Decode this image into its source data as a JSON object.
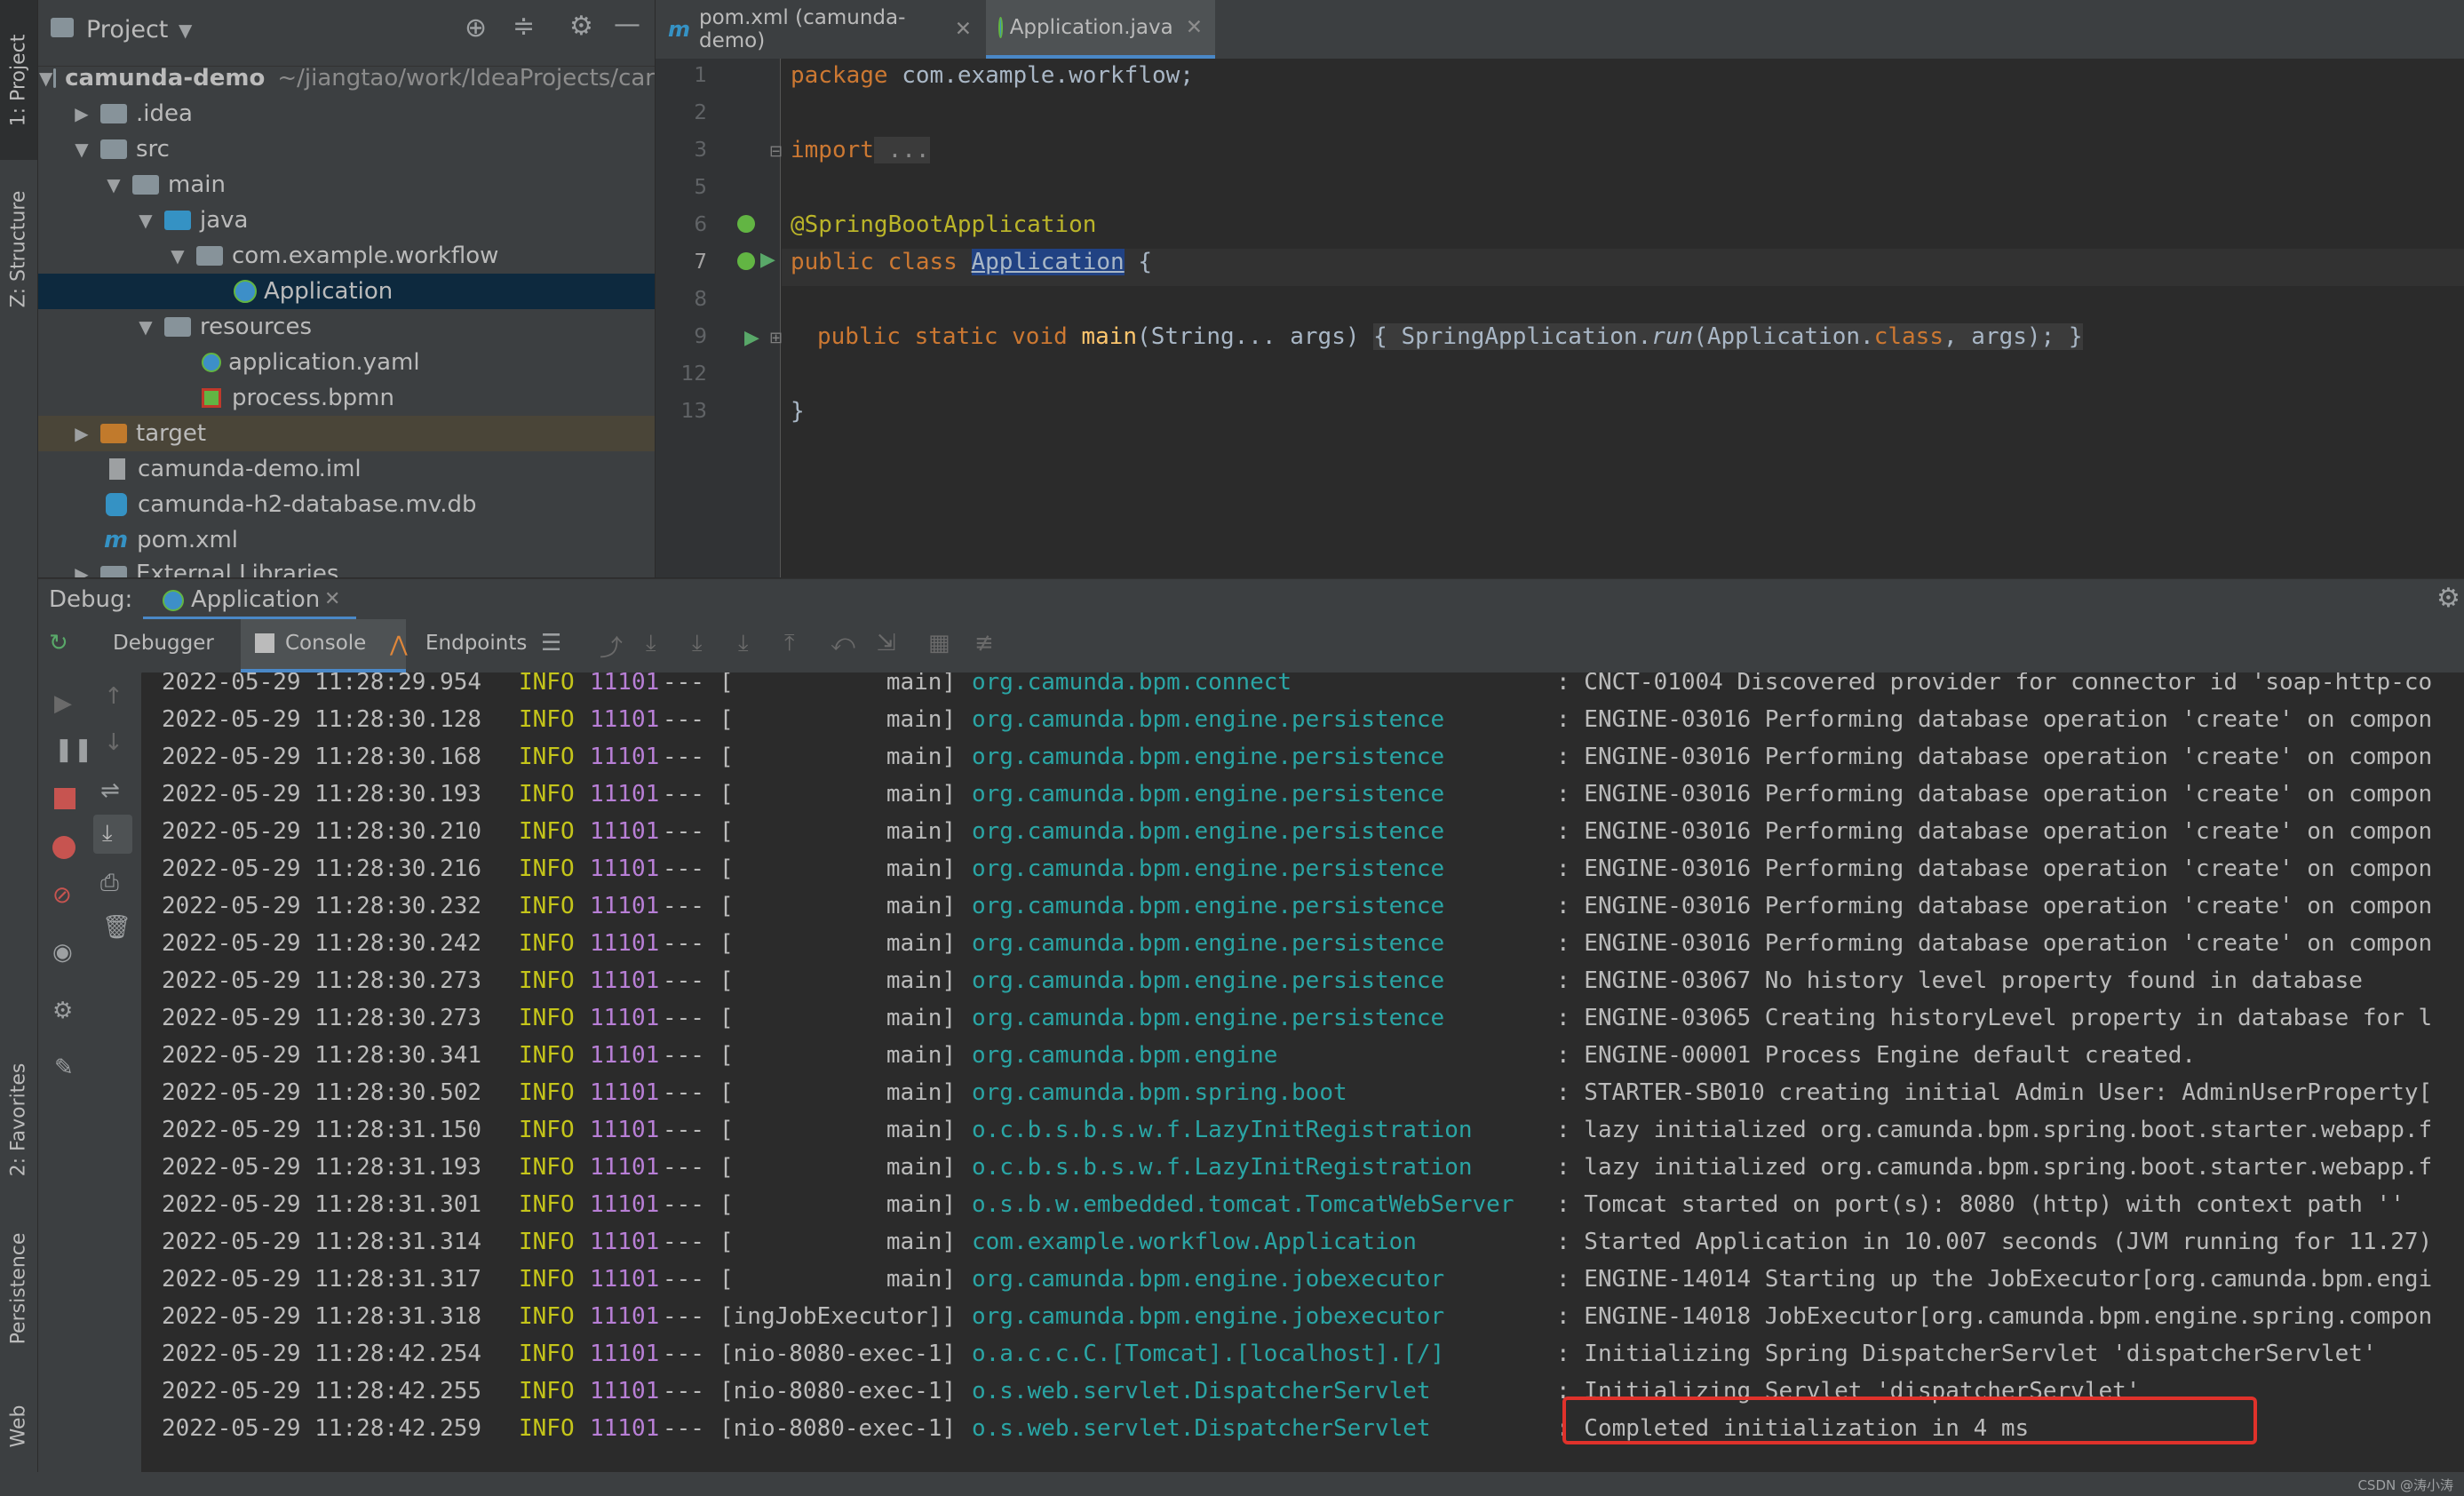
{
  "left_strip": {
    "project_tab": "1: Project",
    "structure_tab": "Z: Structure",
    "favorites_tab": "2: Favorites",
    "persistence_tab": "Persistence",
    "web_tab": "Web"
  },
  "project": {
    "title": "Project",
    "tree": [
      {
        "label": "camunda-demo",
        "path": "~/jiangtao/work/IdeaProjects/car"
      },
      {
        "label": ".idea"
      },
      {
        "label": "src"
      },
      {
        "label": "main"
      },
      {
        "label": "java"
      },
      {
        "label": "com.example.workflow"
      },
      {
        "label": "Application"
      },
      {
        "label": "resources"
      },
      {
        "label": "application.yaml"
      },
      {
        "label": "process.bpmn"
      },
      {
        "label": "target"
      },
      {
        "label": "camunda-demo.iml"
      },
      {
        "label": "camunda-h2-database.mv.db"
      },
      {
        "label": "pom.xml"
      },
      {
        "label": "External Libraries"
      }
    ]
  },
  "editor": {
    "tabs": [
      {
        "label": "pom.xml (camunda-demo)"
      },
      {
        "label": "Application.java"
      }
    ],
    "line_numbers": [
      "1",
      "2",
      "3",
      "5",
      "6",
      "7",
      "8",
      "9",
      "12",
      "13"
    ],
    "code": {
      "l1_kw": "package",
      "l1_rest": " com.example.workflow;",
      "l3_kw": "import",
      "l3_fold": " ...",
      "l6_ann": "@SpringBootApplication",
      "l7_kw": "public class ",
      "l7_cls": "Application",
      "l7_rest": " {",
      "l9_kw": "public static void ",
      "l9_fn": "main",
      "l9_args": "(String... args) ",
      "l9_body": "{ SpringApplication.",
      "l9_run": "run",
      "l9_app": "(Application.",
      "l9_class": "class",
      "l9_end": ", args); }",
      "l13": "}"
    }
  },
  "debug": {
    "label": "Debug:",
    "session": "Application",
    "tabs": {
      "debugger": "Debugger",
      "console": "Console",
      "endpoints": "Endpoints"
    }
  },
  "console": {
    "rows": [
      {
        "ts": "2022-05-29 11:28:29.954",
        "level": "INFO",
        "pid": "11101",
        "sep": "---",
        "thread": "[           main]",
        "logger": "org.camunda.bpm.connect",
        "msg": ": CNCT-01004 Discovered provider for connector id 'soap-http-co"
      },
      {
        "ts": "2022-05-29 11:28:30.128",
        "level": "INFO",
        "pid": "11101",
        "sep": "---",
        "thread": "[           main]",
        "logger": "org.camunda.bpm.engine.persistence",
        "msg": ": ENGINE-03016 Performing database operation 'create' on compon"
      },
      {
        "ts": "2022-05-29 11:28:30.168",
        "level": "INFO",
        "pid": "11101",
        "sep": "---",
        "thread": "[           main]",
        "logger": "org.camunda.bpm.engine.persistence",
        "msg": ": ENGINE-03016 Performing database operation 'create' on compon"
      },
      {
        "ts": "2022-05-29 11:28:30.193",
        "level": "INFO",
        "pid": "11101",
        "sep": "---",
        "thread": "[           main]",
        "logger": "org.camunda.bpm.engine.persistence",
        "msg": ": ENGINE-03016 Performing database operation 'create' on compon"
      },
      {
        "ts": "2022-05-29 11:28:30.210",
        "level": "INFO",
        "pid": "11101",
        "sep": "---",
        "thread": "[           main]",
        "logger": "org.camunda.bpm.engine.persistence",
        "msg": ": ENGINE-03016 Performing database operation 'create' on compon"
      },
      {
        "ts": "2022-05-29 11:28:30.216",
        "level": "INFO",
        "pid": "11101",
        "sep": "---",
        "thread": "[           main]",
        "logger": "org.camunda.bpm.engine.persistence",
        "msg": ": ENGINE-03016 Performing database operation 'create' on compon"
      },
      {
        "ts": "2022-05-29 11:28:30.232",
        "level": "INFO",
        "pid": "11101",
        "sep": "---",
        "thread": "[           main]",
        "logger": "org.camunda.bpm.engine.persistence",
        "msg": ": ENGINE-03016 Performing database operation 'create' on compon"
      },
      {
        "ts": "2022-05-29 11:28:30.242",
        "level": "INFO",
        "pid": "11101",
        "sep": "---",
        "thread": "[           main]",
        "logger": "org.camunda.bpm.engine.persistence",
        "msg": ": ENGINE-03016 Performing database operation 'create' on compon"
      },
      {
        "ts": "2022-05-29 11:28:30.273",
        "level": "INFO",
        "pid": "11101",
        "sep": "---",
        "thread": "[           main]",
        "logger": "org.camunda.bpm.engine.persistence",
        "msg": ": ENGINE-03067 No history level property found in database"
      },
      {
        "ts": "2022-05-29 11:28:30.273",
        "level": "INFO",
        "pid": "11101",
        "sep": "---",
        "thread": "[           main]",
        "logger": "org.camunda.bpm.engine.persistence",
        "msg": ": ENGINE-03065 Creating historyLevel property in database for l"
      },
      {
        "ts": "2022-05-29 11:28:30.341",
        "level": "INFO",
        "pid": "11101",
        "sep": "---",
        "thread": "[           main]",
        "logger": "org.camunda.bpm.engine",
        "msg": ": ENGINE-00001 Process Engine default created."
      },
      {
        "ts": "2022-05-29 11:28:30.502",
        "level": "INFO",
        "pid": "11101",
        "sep": "---",
        "thread": "[           main]",
        "logger": "org.camunda.bpm.spring.boot",
        "msg": ": STARTER-SB010 creating initial Admin User: AdminUserProperty["
      },
      {
        "ts": "2022-05-29 11:28:31.150",
        "level": "INFO",
        "pid": "11101",
        "sep": "---",
        "thread": "[           main]",
        "logger": "o.c.b.s.b.s.w.f.LazyInitRegistration",
        "msg": ": lazy initialized org.camunda.bpm.spring.boot.starter.webapp.f"
      },
      {
        "ts": "2022-05-29 11:28:31.193",
        "level": "INFO",
        "pid": "11101",
        "sep": "---",
        "thread": "[           main]",
        "logger": "o.c.b.s.b.s.w.f.LazyInitRegistration",
        "msg": ": lazy initialized org.camunda.bpm.spring.boot.starter.webapp.f"
      },
      {
        "ts": "2022-05-29 11:28:31.301",
        "level": "INFO",
        "pid": "11101",
        "sep": "---",
        "thread": "[           main]",
        "logger": "o.s.b.w.embedded.tomcat.TomcatWebServer",
        "msg": ": Tomcat started on port(s): 8080 (http) with context path ''"
      },
      {
        "ts": "2022-05-29 11:28:31.314",
        "level": "INFO",
        "pid": "11101",
        "sep": "---",
        "thread": "[           main]",
        "logger": "com.example.workflow.Application",
        "msg": ": Started Application in 10.007 seconds (JVM running for 11.27)"
      },
      {
        "ts": "2022-05-29 11:28:31.317",
        "level": "INFO",
        "pid": "11101",
        "sep": "---",
        "thread": "[           main]",
        "logger": "org.camunda.bpm.engine.jobexecutor",
        "msg": ": ENGINE-14014 Starting up the JobExecutor[org.camunda.bpm.engi"
      },
      {
        "ts": "2022-05-29 11:28:31.318",
        "level": "INFO",
        "pid": "11101",
        "sep": "---",
        "thread": "[ingJobExecutor]]",
        "logger": "org.camunda.bpm.engine.jobexecutor",
        "msg": ": ENGINE-14018 JobExecutor[org.camunda.bpm.engine.spring.compon"
      },
      {
        "ts": "2022-05-29 11:28:42.254",
        "level": "INFO",
        "pid": "11101",
        "sep": "---",
        "thread": "[nio-8080-exec-1]",
        "logger": "o.a.c.c.C.[Tomcat].[localhost].[/]",
        "msg": ": Initializing Spring DispatcherServlet 'dispatcherServlet'"
      },
      {
        "ts": "2022-05-29 11:28:42.255",
        "level": "INFO",
        "pid": "11101",
        "sep": "---",
        "thread": "[nio-8080-exec-1]",
        "logger": "o.s.web.servlet.DispatcherServlet",
        "msg": ": Initializing Servlet 'dispatcherServlet'"
      },
      {
        "ts": "2022-05-29 11:28:42.259",
        "level": "INFO",
        "pid": "11101",
        "sep": "---",
        "thread": "[nio-8080-exec-1]",
        "logger": "o.s.web.servlet.DispatcherServlet",
        "msg": ": Completed initialization in 4 ms"
      }
    ]
  },
  "watermark": "CSDN @涛小涛",
  "colors": {
    "highlight": "#e0322b",
    "accent": "#4a88c7",
    "logger": "#2aa5a5",
    "level": "#c5c51a",
    "pid": "#b87fd6"
  }
}
